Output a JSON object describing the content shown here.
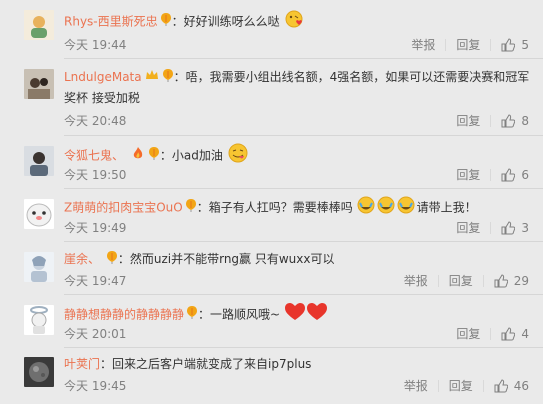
{
  "comments": [
    {
      "user": "Rhys-西里斯死忠",
      "text": "好好训练呀么么哒",
      "time": "今天 19:44",
      "report_label": "举报",
      "reply_label": "回复",
      "likes": "5"
    },
    {
      "user": "LndulgeMata",
      "text": "唔，我需要小组出线名额，4强名额，如果可以还需要决赛和冠军",
      "text2": "奖杯 接受加税",
      "time": "今天 20:48",
      "reply_label": "回复",
      "likes": "8"
    },
    {
      "user": "令狐七鬼、",
      "text": "小ad加油",
      "time": "今天 19:50",
      "reply_label": "回复",
      "likes": "6"
    },
    {
      "user": "Z萌萌的扣肉宝宝OuO",
      "text": "箱子有人扛吗？需要棒棒吗",
      "text_tail": "请带上我！",
      "time": "今天 19:49",
      "reply_label": "回复",
      "likes": "3"
    },
    {
      "user": "崖余、",
      "text": "然而uzi并不能带rng赢 只有wuxx可以",
      "time": "今天 19:47",
      "report_label": "举报",
      "reply_label": "回复",
      "likes": "29"
    },
    {
      "user": "静静想静静的静静静静",
      "text": "一路顺风哦~",
      "time": "今天 20:01",
      "reply_label": "回复",
      "likes": "4"
    },
    {
      "user": "叶荚门",
      "text": "回来之后客户端就变成了来自ip7plus",
      "time": "今天 19:45",
      "report_label": "举报",
      "reply_label": "回复",
      "likes": "46"
    }
  ],
  "colors": {
    "username": "#eb7350",
    "meta": "#808080",
    "background": "#eaeaea"
  },
  "icons": {
    "badge": "balloon-badge-icon",
    "like": "thumbs-up-icon"
  }
}
